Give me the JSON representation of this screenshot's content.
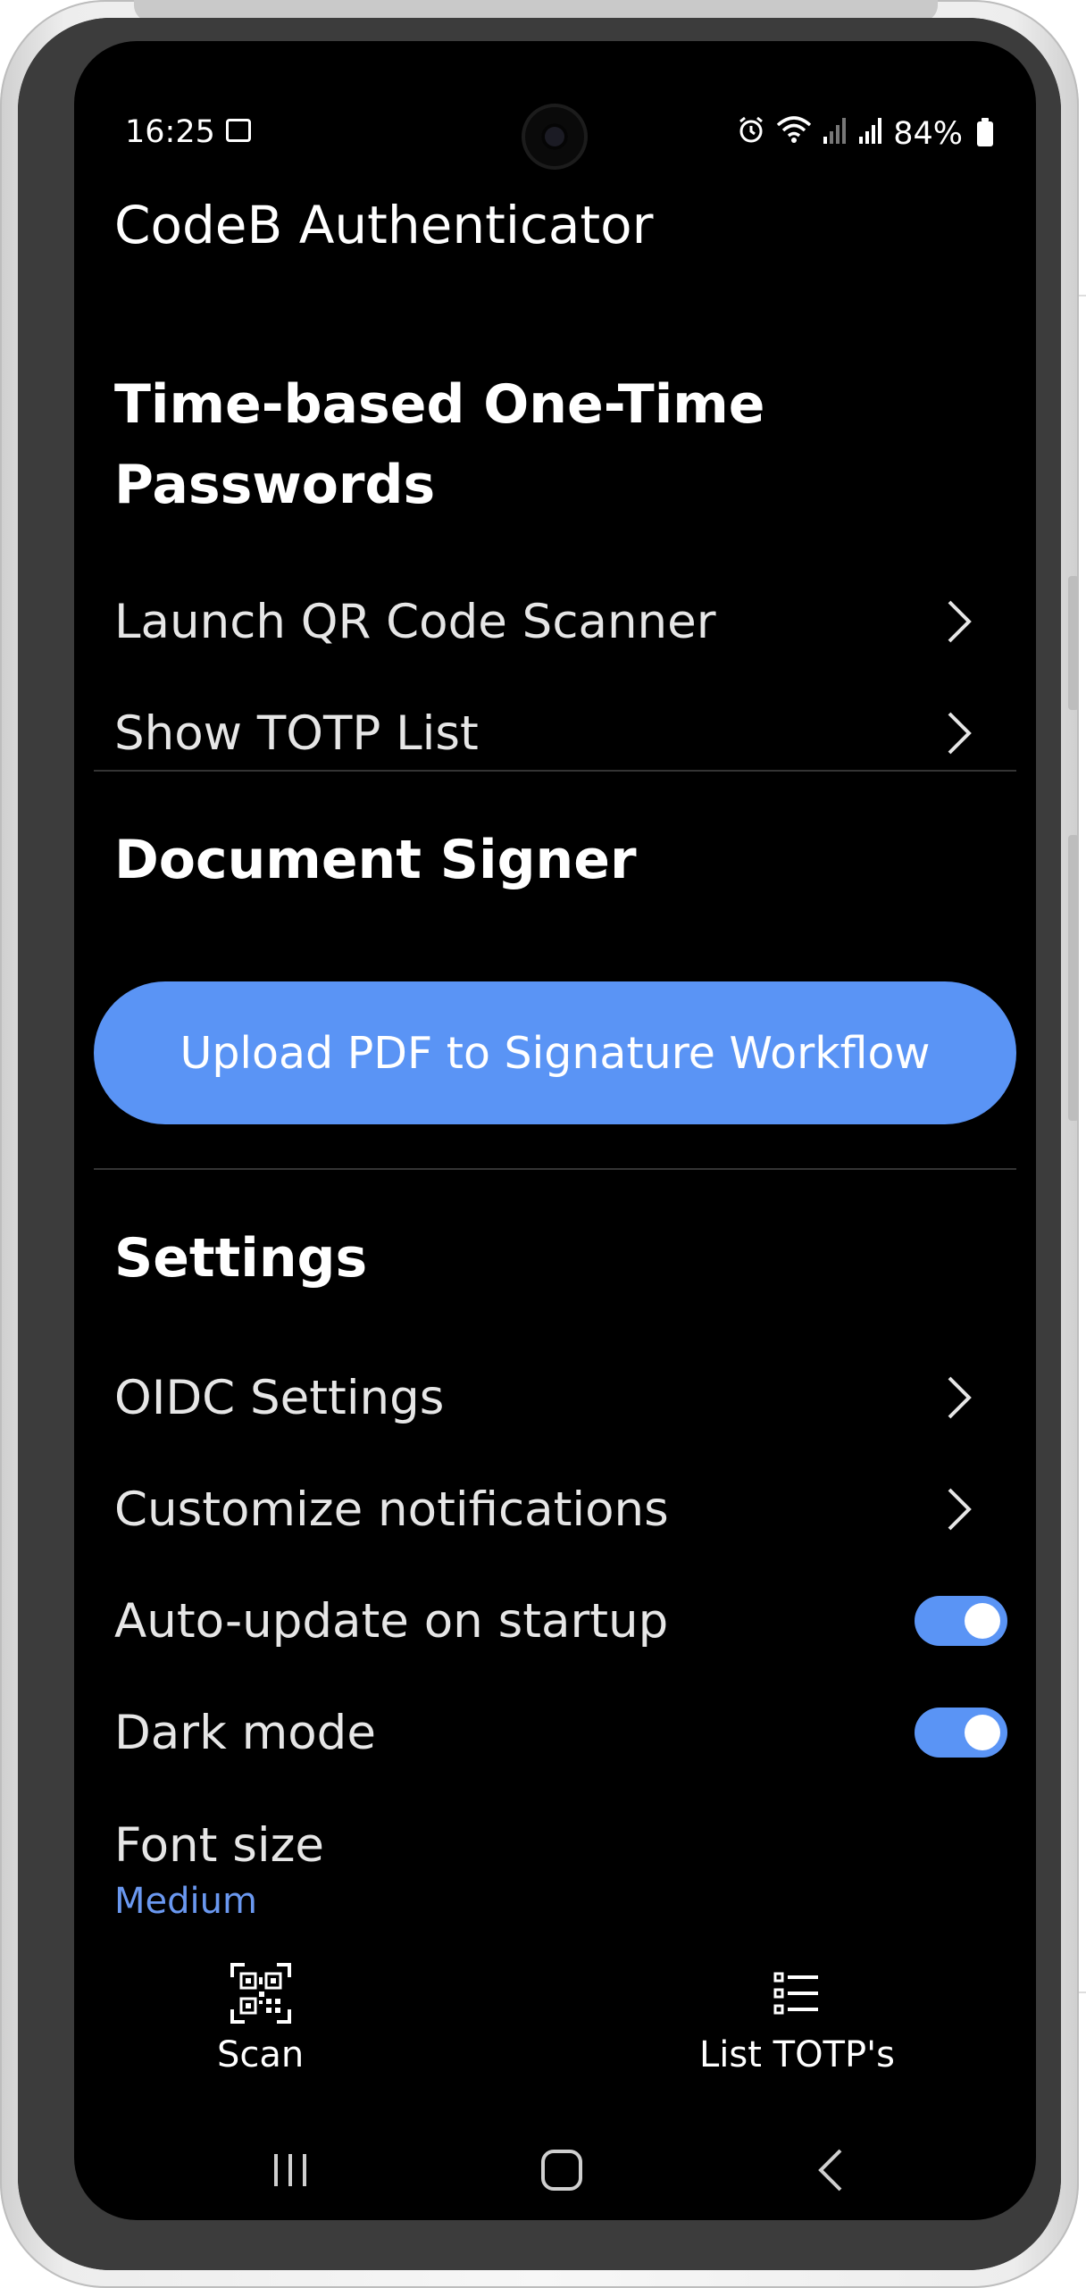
{
  "status_bar": {
    "time": "16:25",
    "battery": "84%",
    "icons": [
      "gallery-icon",
      "alarm-icon",
      "wifi-icon",
      "signal-icon",
      "signal-r-icon",
      "battery-icon"
    ]
  },
  "app": {
    "title": "CodeB Authenticator"
  },
  "totp_section": {
    "title": "Time-based One-Time Passwords",
    "items": [
      {
        "label": "Launch QR Code Scanner"
      },
      {
        "label": "Show TOTP List"
      }
    ]
  },
  "document_signer": {
    "title": "Document Signer",
    "upload_button": "Upload PDF to Signature Workflow"
  },
  "settings": {
    "title": "Settings",
    "items": [
      {
        "label": "OIDC Settings"
      },
      {
        "label": "Customize notifications"
      }
    ],
    "toggles": [
      {
        "label": "Auto-update on startup",
        "on": true
      },
      {
        "label": "Dark mode",
        "on": true
      }
    ],
    "font_size": {
      "label": "Font size",
      "value": "Medium"
    }
  },
  "bottom_nav": {
    "scan_label": "Scan",
    "list_label": "List TOTP's"
  },
  "colors": {
    "accent": "#5a94f5",
    "background": "#000000",
    "value_text": "#6a98f0"
  }
}
